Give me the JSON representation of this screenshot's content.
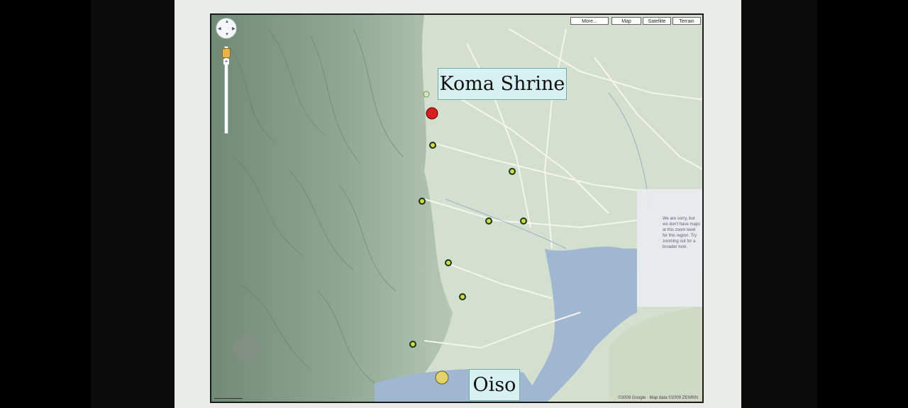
{
  "map": {
    "controls": {
      "more_label": "More...",
      "map_label": "Map",
      "satellite_label": "Satellite",
      "terrain_label": "Terrain"
    },
    "labels": {
      "koma_shrine": "Koma Shrine",
      "oiso": "Oiso"
    },
    "markers": {
      "primary_color": "#d42020",
      "secondary_color": "#e2d26a",
      "waypoint_fill": "#d9d64a",
      "waypoint_stroke": "#143a14"
    },
    "attribution": "©2009 Google · Map data ©2009 ZENRIN",
    "notice_text": "We are sorry, but we don't have maps at this zoom level for this region. Try zooming out for a broader look.",
    "colors": {
      "terrain": "#cfdbc8",
      "mountains": "#7f9a86",
      "water": "#9fb7d1",
      "roads": "#f5f5f0"
    }
  }
}
